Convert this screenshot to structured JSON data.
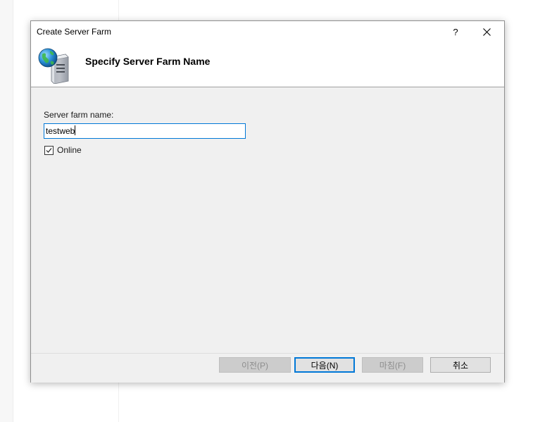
{
  "window": {
    "title": "Create Server Farm",
    "help_label": "?",
    "close_icon": "close-icon"
  },
  "header": {
    "title": "Specify Server Farm Name",
    "icon": "server-globe-icon"
  },
  "form": {
    "name_label": "Server farm name:",
    "name_value": "testweb",
    "online_label": "Online",
    "online_checked": true
  },
  "buttons": {
    "previous": "이전(P)",
    "next": "다음(N)",
    "finish": "마침(F)",
    "cancel": "취소"
  },
  "colors": {
    "accent": "#0078d7",
    "dialog_bg": "#f0f0f0",
    "disabled_text": "#8d8d8d"
  }
}
